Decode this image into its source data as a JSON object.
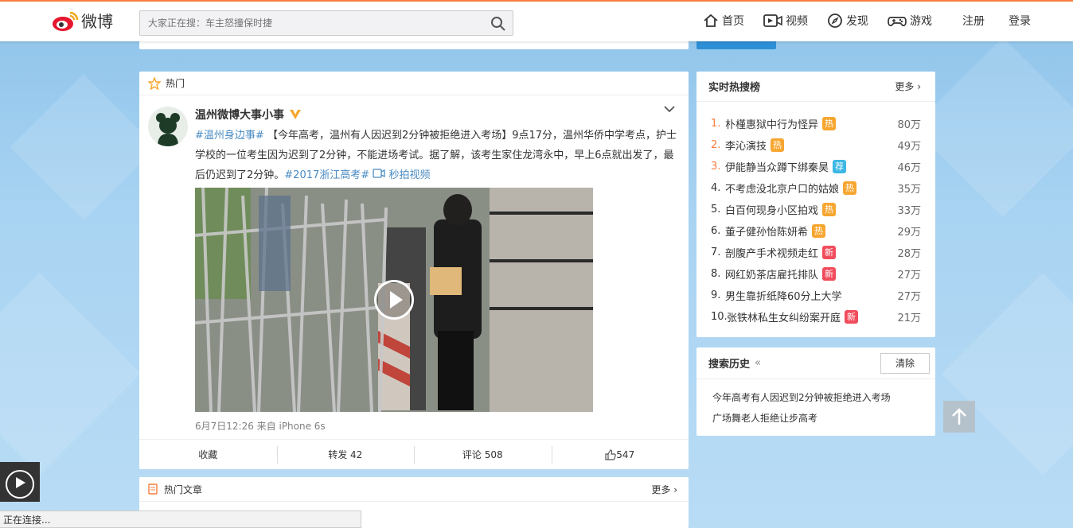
{
  "header": {
    "logo_text": "微博",
    "search_placeholder": "大家正在搜：车主怒撞保时捷",
    "nav": [
      {
        "label": "首页",
        "icon": "home-icon"
      },
      {
        "label": "视频",
        "icon": "video-icon"
      },
      {
        "label": "发现",
        "icon": "compass-icon"
      },
      {
        "label": "游戏",
        "icon": "gamepad-icon"
      }
    ],
    "register": "注册",
    "login": "登录"
  },
  "feed": {
    "section_title": "热门",
    "user_name": "温州微博大事小事",
    "post": {
      "tag1": "#温州身边事#",
      "body": "【今年高考，温州有人因迟到2分钟被拒绝进入考场】9点17分，温州华侨中学考点，护士学校的一位考生因为迟到了2分钟，不能进场考试。据了解，该考生家住龙湾永中，早上6点就出发了，最后仍迟到了2分钟。",
      "tag2": "#2017浙江高考#",
      "video_link": "秒拍视频"
    },
    "meta": "6月7日12:26 来自 iPhone 6s",
    "actions": {
      "favorite": "收藏",
      "repost": "转发 42",
      "comment": "评论 508",
      "like": "547"
    }
  },
  "articles": {
    "title": "热门文章",
    "more": "更多"
  },
  "hot_search": {
    "title": "实时热搜榜",
    "more": "更多",
    "items": [
      {
        "rank": "1.",
        "word": "朴槿惠狱中行为怪异",
        "badge": "热",
        "badge_color": "#f7a630",
        "count": "80万"
      },
      {
        "rank": "2.",
        "word": "李沁演技",
        "badge": "热",
        "badge_color": "#f7a630",
        "count": "49万"
      },
      {
        "rank": "3.",
        "word": "伊能静当众蹲下绑秦昊",
        "badge": "荐",
        "badge_color": "#3bb7e5",
        "count": "46万"
      },
      {
        "rank": "4.",
        "word": "不考虑没北京户口的姑娘",
        "badge": "热",
        "badge_color": "#f7a630",
        "count": "35万"
      },
      {
        "rank": "5.",
        "word": "白百何现身小区拍戏",
        "badge": "热",
        "badge_color": "#f7a630",
        "count": "33万"
      },
      {
        "rank": "6.",
        "word": "董子健孙怡陈妍希",
        "badge": "热",
        "badge_color": "#f7a630",
        "count": "29万"
      },
      {
        "rank": "7.",
        "word": "剖腹产手术视频走红",
        "badge": "新",
        "badge_color": "#f14c5c",
        "count": "28万"
      },
      {
        "rank": "8.",
        "word": "网红奶茶店雇托排队",
        "badge": "新",
        "badge_color": "#f14c5c",
        "count": "27万"
      },
      {
        "rank": "9.",
        "word": "男生靠折纸降60分上大学",
        "badge": "",
        "badge_color": "",
        "count": "27万"
      },
      {
        "rank": "10.",
        "word": "张铁林私生女纠纷案开庭",
        "badge": "新",
        "badge_color": "#f14c5c",
        "count": "21万"
      }
    ]
  },
  "search_history": {
    "title": "搜索历史",
    "collapse": "«",
    "clear": "清除",
    "items": [
      "今年高考有人因迟到2分钟被拒绝进入考场",
      "广场舞老人拒绝让步高考"
    ]
  },
  "status_bar": "正在连接..."
}
